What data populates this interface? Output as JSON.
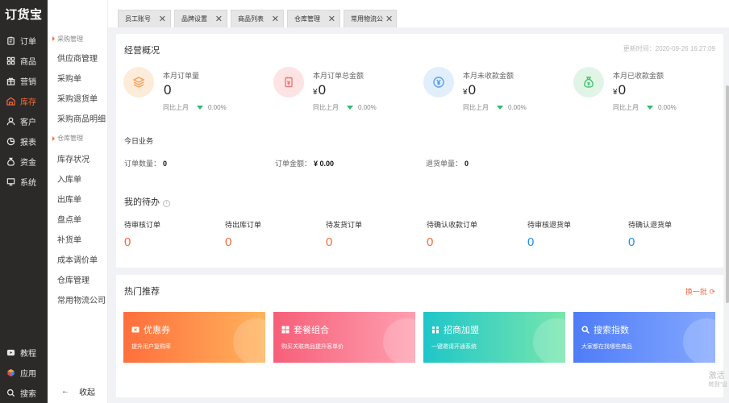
{
  "app": {
    "logo": "订货宝"
  },
  "rail": {
    "items": [
      {
        "label": "订单",
        "icon": "clipboard-icon"
      },
      {
        "label": "商品",
        "icon": "grid-icon"
      },
      {
        "label": "营销",
        "icon": "gift-icon"
      },
      {
        "label": "库存",
        "icon": "warehouse-icon",
        "active": true
      },
      {
        "label": "客户",
        "icon": "user-icon"
      },
      {
        "label": "报表",
        "icon": "pie-chart-icon"
      },
      {
        "label": "资金",
        "icon": "money-bag-icon"
      },
      {
        "label": "系统",
        "icon": "monitor-icon"
      }
    ],
    "bottom": [
      {
        "label": "教程",
        "icon": "play-icon"
      },
      {
        "label": "应用",
        "icon": "cube-icon"
      },
      {
        "label": "搜索",
        "icon": "search-icon"
      }
    ]
  },
  "subnav": {
    "groups": [
      {
        "title": "采购管理",
        "items": [
          "供应商管理",
          "采购单",
          "采购退货单",
          "采购商品明细"
        ]
      },
      {
        "title": "仓库管理",
        "items": [
          "库存状况",
          "入库单",
          "出库单",
          "盘点单",
          "补货单",
          "成本调价单",
          "仓库管理",
          "常用物流公司"
        ]
      }
    ],
    "collapse_label": "收起"
  },
  "tabs": [
    "员工账号",
    "品牌设置",
    "商品列表",
    "仓库管理",
    "常用物流公"
  ],
  "overview": {
    "title": "经营概况",
    "update_time": "更新时间：2020-09-26 16:27:09",
    "stats": [
      {
        "label": "本月订单量",
        "value": "0",
        "currency": "",
        "compare_label": "同比上月",
        "compare_value": "0.00%",
        "icon": "layers-icon",
        "bg": "#fdecd9",
        "fg": "#f5a05a"
      },
      {
        "label": "本月订单总金额",
        "value": "0",
        "currency": "¥",
        "compare_label": "同比上月",
        "compare_value": "0.00%",
        "icon": "receipt-icon",
        "bg": "#fde3e3",
        "fg": "#f07777"
      },
      {
        "label": "本月未收款金额",
        "value": "0",
        "currency": "¥",
        "compare_label": "同比上月",
        "compare_value": "0.00%",
        "icon": "yen-coin-icon",
        "bg": "#e1eefc",
        "fg": "#5aa0ee"
      },
      {
        "label": "本月已收款金额",
        "value": "0",
        "currency": "¥",
        "compare_label": "同比上月",
        "compare_value": "0.00%",
        "icon": "money-bag-icon",
        "bg": "#e0f5e6",
        "fg": "#45c26e"
      }
    ],
    "today_title": "今日业务",
    "today": [
      {
        "label": "订单数量：",
        "value": "0"
      },
      {
        "label": "订单金额：",
        "value": "¥ 0.00"
      },
      {
        "label": "退货单量：",
        "value": "0"
      }
    ]
  },
  "todo": {
    "title": "我的待办",
    "items": [
      {
        "label": "待审核订单",
        "value": "0",
        "color": "#f36b3b"
      },
      {
        "label": "待出库订单",
        "value": "0",
        "color": "#f36b3b"
      },
      {
        "label": "待发货订单",
        "value": "0",
        "color": "#f36b3b"
      },
      {
        "label": "待确认收款订单",
        "value": "0",
        "color": "#f36b3b"
      },
      {
        "label": "待审核退货单",
        "value": "0",
        "color": "#1f8fe6"
      },
      {
        "label": "待确认退货单",
        "value": "0",
        "color": "#1f8fe6"
      }
    ]
  },
  "hot": {
    "title": "热门推荐",
    "refresh_label": "换一批",
    "promos": [
      {
        "title": "优惠券",
        "subtitle": "提升用户复购率",
        "icon": "coupon-icon",
        "from": "#ff6f3c",
        "to": "#ffb35c"
      },
      {
        "title": "套餐组合",
        "subtitle": "购买关联商品提升客单价",
        "icon": "combo-icon",
        "from": "#f65f78",
        "to": "#ff9fb0"
      },
      {
        "title": "招商加盟",
        "subtitle": "一键邀请开通系统",
        "icon": "franchise-icon",
        "from": "#1fc6c9",
        "to": "#77e6ad"
      },
      {
        "title": "搜索指数",
        "subtitle": "大家都在找哪些商品",
        "icon": "search-icon",
        "from": "#4f7cf7",
        "to": "#83a8ff"
      }
    ]
  },
  "watermark": {
    "line1": "激活",
    "line2": "转到\"设"
  }
}
